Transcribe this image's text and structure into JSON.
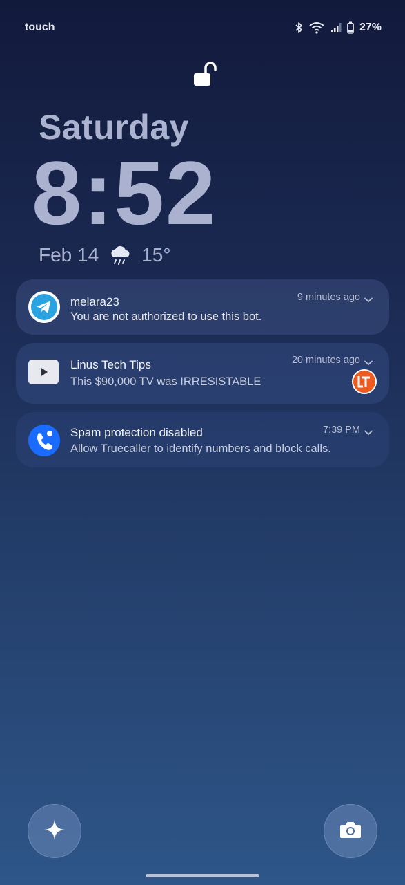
{
  "status_bar": {
    "carrier": "touch",
    "battery": "27%",
    "icons": [
      "bluetooth-icon",
      "wifi-icon",
      "signal-icon",
      "battery-icon"
    ]
  },
  "lock": {
    "icon": "unlock-icon"
  },
  "clock": {
    "day": "Saturday",
    "time": "8:52",
    "date": "Feb 14",
    "weather_icon": "rain-cloud-icon",
    "temperature": "15°"
  },
  "notifications": [
    {
      "app_icon": "telegram-icon",
      "title": "melara23",
      "body": "You are not authorized to use this bot.",
      "time": "9 minutes ago"
    },
    {
      "app_icon": "youtube-icon",
      "title": "Linus Tech Tips",
      "body": "This $90,000 TV was IRRESISTABLE",
      "time": "20 minutes ago",
      "badge_icon": "ltt-channel-icon"
    },
    {
      "app_icon": "truecaller-icon",
      "title": "Spam protection disabled",
      "body": "Allow Truecaller to identify numbers and block calls.",
      "time": "7:39 PM"
    }
  ],
  "shortcuts": {
    "left_icon": "sparkle-icon",
    "right_icon": "camera-icon"
  },
  "colors": {
    "clock_text": "#aab2d0",
    "telegram": "#2aa3e0",
    "truecaller": "#1a6bff",
    "ltt_orange": "#ee5a1f"
  }
}
